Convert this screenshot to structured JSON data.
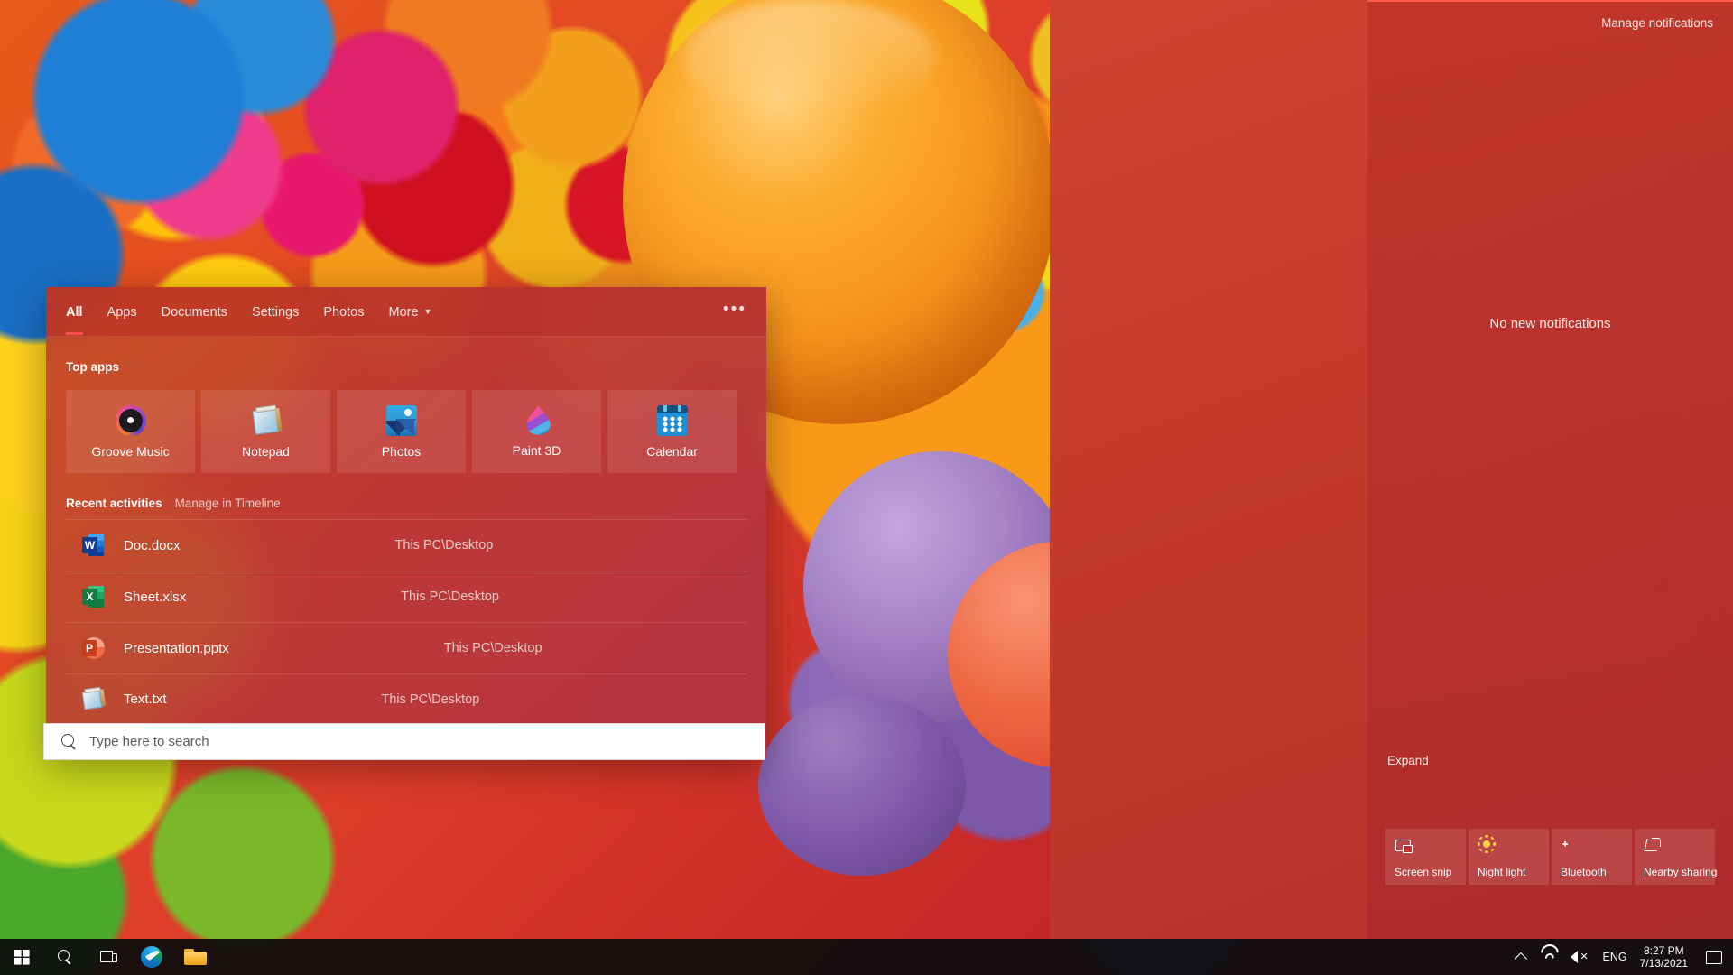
{
  "search_panel": {
    "tabs": [
      {
        "label": "All",
        "active": true
      },
      {
        "label": "Apps",
        "active": false
      },
      {
        "label": "Documents",
        "active": false
      },
      {
        "label": "Settings",
        "active": false
      },
      {
        "label": "Photos",
        "active": false
      },
      {
        "label": "More",
        "active": false,
        "chevron": "▼"
      }
    ],
    "overflow_label": "•••",
    "top_apps_title": "Top apps",
    "top_apps": [
      {
        "label": "Groove Music",
        "icon": "groove-music-icon"
      },
      {
        "label": "Notepad",
        "icon": "notepad-icon"
      },
      {
        "label": "Photos",
        "icon": "photos-icon"
      },
      {
        "label": "Paint 3D",
        "icon": "paint-3d-icon"
      },
      {
        "label": "Calendar",
        "icon": "calendar-icon"
      }
    ],
    "recent_title": "Recent activities",
    "recent_link": "Manage in Timeline",
    "recent_files": [
      {
        "name": "Doc.docx",
        "location": "This PC\\Desktop",
        "icon": "word-icon"
      },
      {
        "name": "Sheet.xlsx",
        "location": "This PC\\Desktop",
        "icon": "excel-icon"
      },
      {
        "name": "Presentation.pptx",
        "location": "This PC\\Desktop",
        "icon": "powerpoint-icon"
      },
      {
        "name": "Text.txt",
        "location": "This PC\\Desktop",
        "icon": "notepad-file-icon"
      }
    ],
    "search_input": {
      "value": "",
      "placeholder": "Type here to search",
      "icon": "search-icon"
    }
  },
  "action_center": {
    "manage_notifications": "Manage notifications",
    "empty_state": "No new notifications",
    "expand_label": "Expand",
    "quick_actions": [
      {
        "label": "Screen snip",
        "icon": "screen-snip-icon"
      },
      {
        "label": "Night light",
        "icon": "night-light-icon"
      },
      {
        "label": "Bluetooth",
        "icon": "bluetooth-icon"
      },
      {
        "label": "Nearby sharing",
        "icon": "nearby-sharing-icon"
      }
    ]
  },
  "taskbar": {
    "start": {
      "label": "Start",
      "icon": "windows-start-icon"
    },
    "search": {
      "label": "Search",
      "icon": "search-icon"
    },
    "task_view": {
      "label": "Task View",
      "icon": "task-view-icon"
    },
    "pinned": [
      {
        "label": "Microsoft Edge",
        "icon": "edge-icon"
      },
      {
        "label": "File Explorer",
        "icon": "file-explorer-icon"
      }
    ],
    "tray": {
      "show_hidden": {
        "label": "Show hidden icons",
        "icon": "chevron-up-icon"
      },
      "network": {
        "label": "Network",
        "icon": "wifi-icon"
      },
      "volume": {
        "label": "Volume muted",
        "icon": "volume-mute-icon"
      },
      "language": "ENG",
      "time": "8:27 PM",
      "date": "7/13/2021",
      "action_center": {
        "label": "Action Center",
        "icon": "action-center-icon"
      }
    }
  },
  "colors": {
    "accent": "#c4402a",
    "active_tab_underline": "#ff4d4d",
    "panel_text": "#ffffff",
    "muted_text": "#f0c8c2"
  }
}
